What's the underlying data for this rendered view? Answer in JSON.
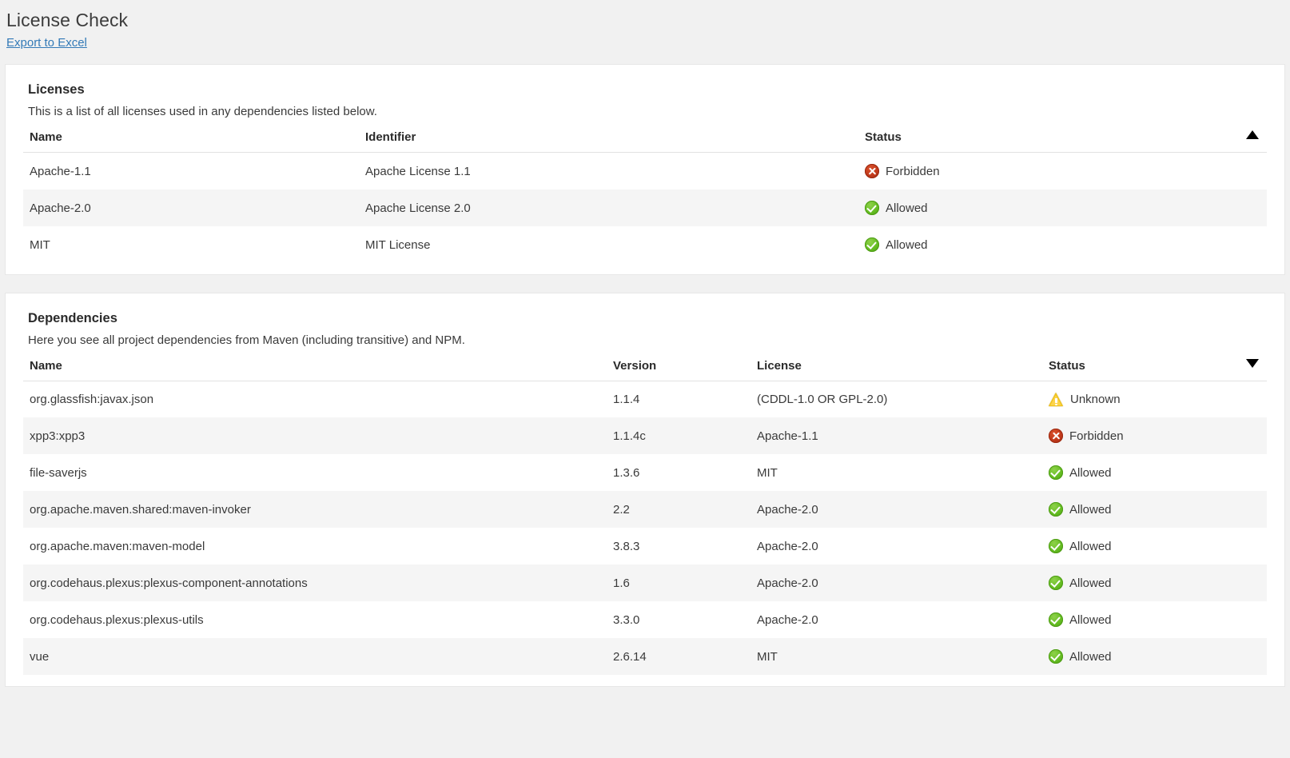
{
  "header": {
    "title": "License Check",
    "export_link": "Export to Excel"
  },
  "licenses_section": {
    "title": "Licenses",
    "subtitle": "This is a list of all licenses used in any dependencies listed below.",
    "columns": [
      "Name",
      "Identifier",
      "Status"
    ],
    "sort": {
      "column": "Status",
      "direction": "ascending",
      "glyph": "triangle-up"
    },
    "rows": [
      {
        "name": "Apache-1.1",
        "identifier": "Apache License 1.1",
        "status": "Forbidden",
        "status_icon": "forbidden-icon"
      },
      {
        "name": "Apache-2.0",
        "identifier": "Apache License 2.0",
        "status": "Allowed",
        "status_icon": "allowed-icon"
      },
      {
        "name": "MIT",
        "identifier": "MIT License",
        "status": "Allowed",
        "status_icon": "allowed-icon"
      }
    ]
  },
  "dependencies_section": {
    "title": "Dependencies",
    "subtitle": "Here you see all project dependencies from Maven (including transitive) and NPM.",
    "columns": [
      "Name",
      "Version",
      "License",
      "Status"
    ],
    "sort": {
      "column": "Status",
      "direction": "descending",
      "glyph": "triangle-down"
    },
    "rows": [
      {
        "name": "org.glassfish:javax.json",
        "version": "1.1.4",
        "license": "(CDDL-1.0 OR GPL-2.0)",
        "status": "Unknown",
        "status_icon": "unknown-icon"
      },
      {
        "name": "xpp3:xpp3",
        "version": "1.1.4c",
        "license": "Apache-1.1",
        "status": "Forbidden",
        "status_icon": "forbidden-icon"
      },
      {
        "name": "file-saverjs",
        "version": "1.3.6",
        "license": "MIT",
        "status": "Allowed",
        "status_icon": "allowed-icon"
      },
      {
        "name": "org.apache.maven.shared:maven-invoker",
        "version": "2.2",
        "license": "Apache-2.0",
        "status": "Allowed",
        "status_icon": "allowed-icon"
      },
      {
        "name": "org.apache.maven:maven-model",
        "version": "3.8.3",
        "license": "Apache-2.0",
        "status": "Allowed",
        "status_icon": "allowed-icon"
      },
      {
        "name": "org.codehaus.plexus:plexus-component-annotations",
        "version": "1.6",
        "license": "Apache-2.0",
        "status": "Allowed",
        "status_icon": "allowed-icon"
      },
      {
        "name": "org.codehaus.plexus:plexus-utils",
        "version": "3.3.0",
        "license": "Apache-2.0",
        "status": "Allowed",
        "status_icon": "allowed-icon"
      },
      {
        "name": "vue",
        "version": "2.6.14",
        "license": "MIT",
        "status": "Allowed",
        "status_icon": "allowed-icon"
      }
    ]
  },
  "colors": {
    "page_background": "#f1f1f1",
    "card_background": "#ffffff",
    "link": "#337ab7",
    "status_allowed": "#65bd22",
    "status_forbidden": "#c0391b",
    "status_unknown": "#f0c419",
    "row_stripe": "#f5f5f5"
  }
}
